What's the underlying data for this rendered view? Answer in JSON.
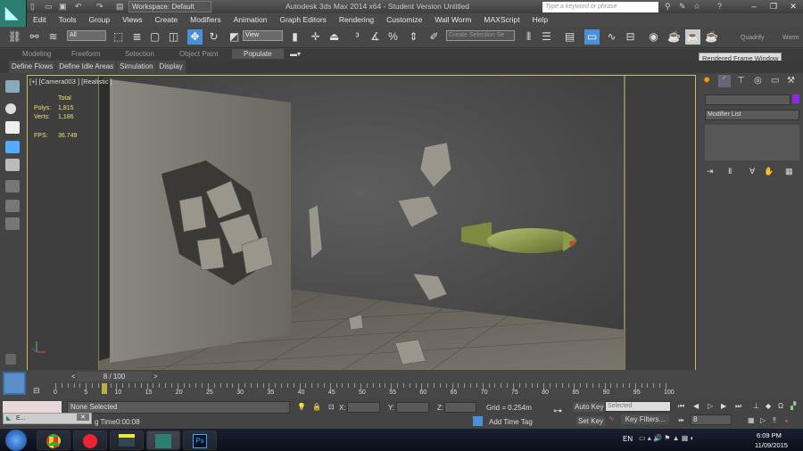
{
  "titlebar": {
    "workspace": "Workspace: Default",
    "title": "Autodesk 3ds Max  2014 x64  - Student Version   Untitled",
    "search_placeholder": "Type a keyword or phrase"
  },
  "menu": [
    "Edit",
    "Tools",
    "Group",
    "Views",
    "Create",
    "Modifiers",
    "Animation",
    "Graph Editors",
    "Rendering",
    "Customize",
    "Wall Worm",
    "MAXScript",
    "Help"
  ],
  "toolbar": {
    "selection_filter": "All",
    "ref_coord": "View",
    "selection_set": "Create Selection Se",
    "quadrify": "Quadrify",
    "worm": "Worm",
    "tooltip": "Rendered Frame Window"
  },
  "ribbon": {
    "tabs": [
      "Modeling",
      "Freeform",
      "Selection",
      "Object Paint",
      "Populate"
    ],
    "active": "Populate",
    "subtabs": [
      "Define Flows",
      "Define Idle Areas",
      "Simulation",
      "Display"
    ]
  },
  "viewport": {
    "label": "[+] [Camera003 ] [Realistic ]",
    "stats": {
      "header": "Total",
      "polys_label": "Polys:",
      "polys": "1,815",
      "verts_label": "Verts:",
      "verts": "1,186",
      "fps_label": "FPS:",
      "fps": "36.749"
    }
  },
  "command_panel": {
    "modifier_list": "Modifier List",
    "object_color": "#8a2be2"
  },
  "timeline": {
    "frame": "8 / 100",
    "current_frame": 8,
    "ticks": [
      "0",
      "5",
      "10",
      "15",
      "20",
      "25",
      "30",
      "35",
      "40",
      "45",
      "50",
      "55",
      "60",
      "65",
      "70",
      "75",
      "80",
      "85",
      "90",
      "95",
      "100"
    ]
  },
  "status": {
    "selection": "None Selected",
    "x_label": "X:",
    "y_label": "Y:",
    "z_label": "Z:",
    "grid": "Grid = 0.254m",
    "time_prefix": "g Time",
    "time": "0:00:08",
    "add_time_tag": "Add Time Tag",
    "auto_key": "Auto Key",
    "set_key": "Set Key",
    "key_mode": "Selected",
    "key_filters": "Key Filters...",
    "frame_field": "8",
    "mini_window": "E..."
  },
  "taskbar": {
    "lang": "EN",
    "time": "6:09 PM",
    "date": "11/09/2015"
  },
  "colors": {
    "accent": "#4a90d9",
    "viewport_border": "#c8c060",
    "stats": "#e8e270",
    "logo": "#2c7f70"
  }
}
